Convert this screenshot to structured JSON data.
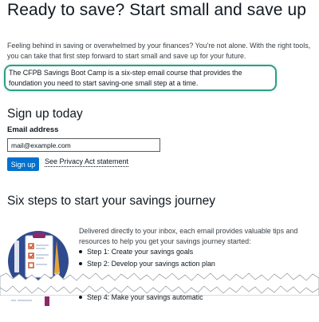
{
  "hero": {
    "title": "Ready to save? Start small and save up",
    "intro": "Feeling behind in saving or overwhelmed by your finances? You're not alone. With the right tools, you can take that first step forward to start small and save up for your future.",
    "callout": "The CFPB Savings Boot Camp is a six-step email course that provides the foundation you need to start saving-one small step at a time."
  },
  "signup": {
    "heading": "Sign up today",
    "email_label": "Email address",
    "email_placeholder": "mail@example.com",
    "button_label": "Sign up",
    "privacy_link": "See Privacy Act statement"
  },
  "steps": {
    "heading": "Six steps to start your savings journey",
    "intro": "Delivered directly to your inbox, each email provides valuable tips and resources to help you get your savings journey started:",
    "items_visible": [
      "Step 1: Create your savings goals",
      "Step 2: Develop your savings action plan"
    ],
    "items_after_tear": [
      "Step 4: Make your savings automatic"
    ]
  },
  "colors": {
    "primary_button": "#0072ce",
    "callout_border": "#2d9e86",
    "text": "#101820"
  },
  "icons": {
    "illustration": "clipboard-checklist-icon"
  }
}
